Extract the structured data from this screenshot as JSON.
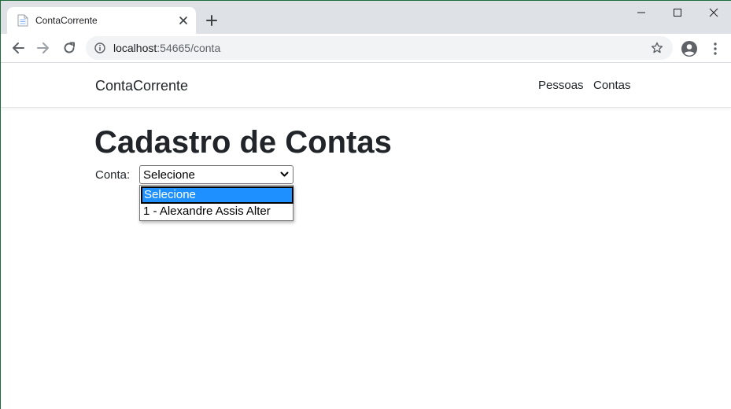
{
  "browser": {
    "tab": {
      "title": "ContaCorrente",
      "favicon": "document-icon",
      "close_icon": "close-icon"
    },
    "new_tab_icon": "plus-icon",
    "window_controls": [
      "minimize-icon",
      "maximize-icon",
      "close-icon"
    ],
    "toolbar": {
      "back_icon": "arrow-left-icon",
      "forward_icon": "arrow-right-icon",
      "reload_icon": "reload-icon",
      "site_info_icon": "info-icon",
      "url_host": "localhost",
      "url_path": ":54665/conta",
      "bookmark_icon": "star-icon",
      "profile_icon": "account-circle-icon",
      "menu_icon": "three-dots-vertical-icon"
    }
  },
  "site": {
    "brand": "ContaCorrente",
    "nav": [
      "Pessoas",
      "Contas"
    ]
  },
  "main": {
    "title": "Cadastro de Contas",
    "conta_label": "Conta:",
    "select_value": "Selecione",
    "options": [
      "Selecione",
      "1 - Alexandre Assis Alter"
    ],
    "selected_option_color": "#1e90ff"
  }
}
